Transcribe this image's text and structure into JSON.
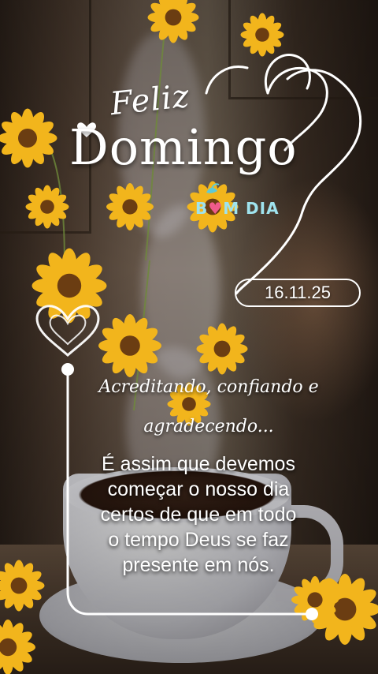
{
  "card": {
    "title_small": "Feliz",
    "title_large": "Domingo",
    "greeting_left": "B",
    "greeting_heart": "♥",
    "greeting_right": "M DIA",
    "date": "16.11.25",
    "script_line1": "Acreditando, confiando e",
    "script_line2": "agradecendo...",
    "message_lines": [
      "É assim que devemos",
      "começar o nosso dia",
      "certos de que em todo",
      "o tempo Deus se faz",
      "presente em nós."
    ]
  },
  "colors": {
    "text": "#ffffff",
    "greeting": "#9fe3ee",
    "heart": "#ef5b8a",
    "sunflower": "#f2b51c",
    "sunflower_center": "#6b3d12"
  },
  "icons": [
    "heart-outline-icon",
    "double-heart-outline-icon",
    "sunflower-icon",
    "bird-icon"
  ]
}
